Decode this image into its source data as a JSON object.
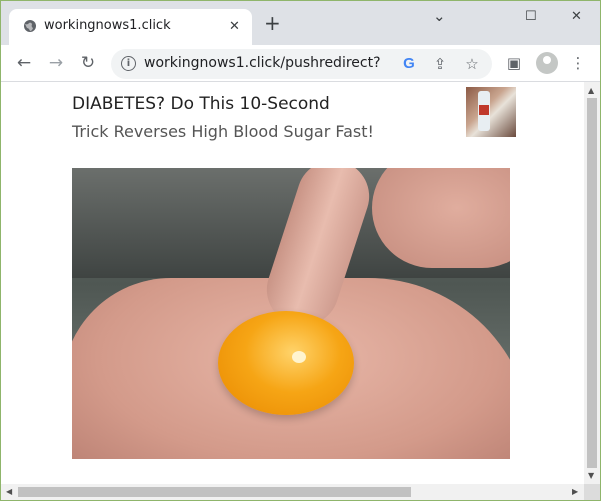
{
  "tab": {
    "title": "workingnows1.click",
    "close_glyph": "✕",
    "favicon": "globe-icon"
  },
  "newtab_glyph": "+",
  "window_controls": {
    "minimize": "⌄",
    "maximize": "☐",
    "close": "✕"
  },
  "toolbar": {
    "back_glyph": "←",
    "forward_glyph": "→",
    "reload_glyph": "↻",
    "url": "workingnows1.click/pushredirect?",
    "info_glyph": "i",
    "google_glyph": "G",
    "share_glyph": "⇪",
    "star_glyph": "☆",
    "sidepanel_glyph": "▣",
    "menu_glyph": "⋮"
  },
  "content": {
    "headline_line1": "DIABETES? Do This 10-Second",
    "headline_line2": "Trick Reverses High Blood Sugar Fast!"
  },
  "scrollbars": {
    "up": "▲",
    "down": "▼",
    "left": "◀",
    "right": "▶"
  }
}
